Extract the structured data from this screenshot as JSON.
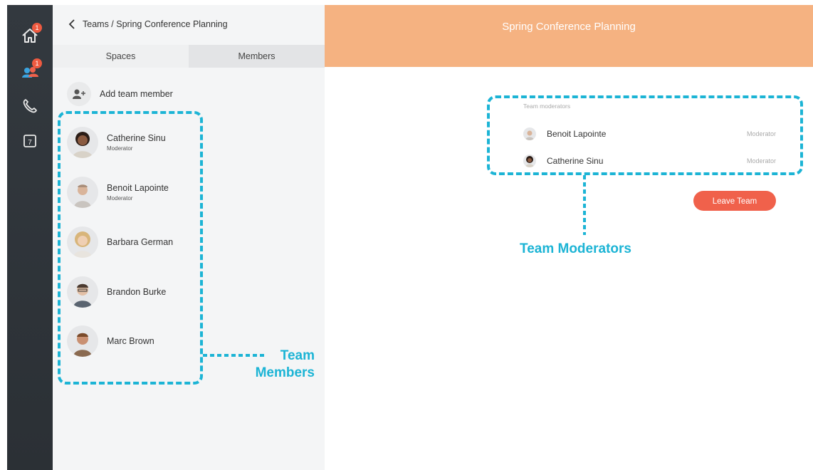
{
  "nav": {
    "home_badge": "1",
    "teams_badge": "1",
    "calendar_day": "7"
  },
  "breadcrumb": "Teams / Spring Conference Planning",
  "tabs": [
    "Spaces",
    "Members"
  ],
  "add_member_label": "Add team member",
  "members": [
    {
      "name": "Catherine Sinu",
      "role": "Moderator"
    },
    {
      "name": "Benoit Lapointe",
      "role": "Moderator"
    },
    {
      "name": "Barbara German",
      "role": ""
    },
    {
      "name": "Brandon Burke",
      "role": ""
    },
    {
      "name": "Marc Brown",
      "role": ""
    }
  ],
  "header_title": "Spring Conference Planning",
  "moderators_section": {
    "label": "Team moderators",
    "items": [
      {
        "name": "Benoit Lapointe",
        "role": "Moderator"
      },
      {
        "name": "Catherine Sinu",
        "role": "Moderator"
      }
    ]
  },
  "leave_button": "Leave Team",
  "annotations": {
    "members_line1": "Team",
    "members_line2": "Members",
    "moderators": "Team Moderators"
  },
  "colors": {
    "header": "#f5b281",
    "accent_annotation": "#1cb4d5",
    "leave_button": "#f0614b",
    "rail": "#2f3439",
    "badge": "#ee5a40"
  }
}
